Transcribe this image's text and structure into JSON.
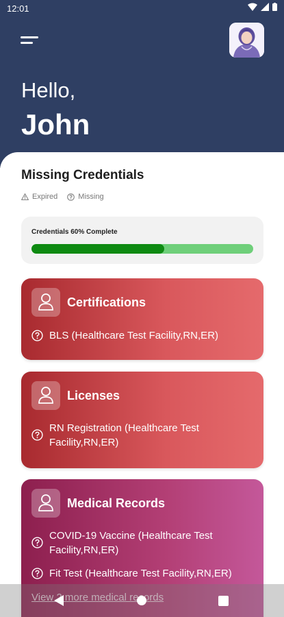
{
  "status_bar": {
    "time": "12:01"
  },
  "header": {
    "greeting": "Hello,",
    "user_name": "John"
  },
  "missing": {
    "title": "Missing Credentials",
    "legend": {
      "expired": "Expired",
      "missing": "Missing"
    }
  },
  "progress": {
    "label": "Credentials 60% Complete",
    "percent": 60
  },
  "cards": {
    "certifications": {
      "title": "Certifications",
      "items": [
        "BLS (Healthcare Test Facility,RN,ER)"
      ]
    },
    "licenses": {
      "title": "Licenses",
      "items": [
        "RN Registration (Healthcare Test Facility,RN,ER)"
      ]
    },
    "medical": {
      "title": "Medical Records",
      "items": [
        "COVID-19 Vaccine (Healthcare Test Facility,RN,ER)",
        "Fit Test (Healthcare Test Facility,RN,ER)"
      ],
      "more_link": "View 2 more medical records"
    }
  },
  "colors": {
    "header_bg": "#2f3f63",
    "progress_fill": "#0e8a12",
    "progress_track": "#6fcf7a",
    "card_red": "#d9585c",
    "card_purple": "#b33f75"
  },
  "icons": {
    "menu": "hamburger-menu-icon",
    "avatar": "nurse-avatar",
    "expired": "warning-triangle-icon",
    "missing": "question-circle-icon",
    "card": "person-icon"
  }
}
